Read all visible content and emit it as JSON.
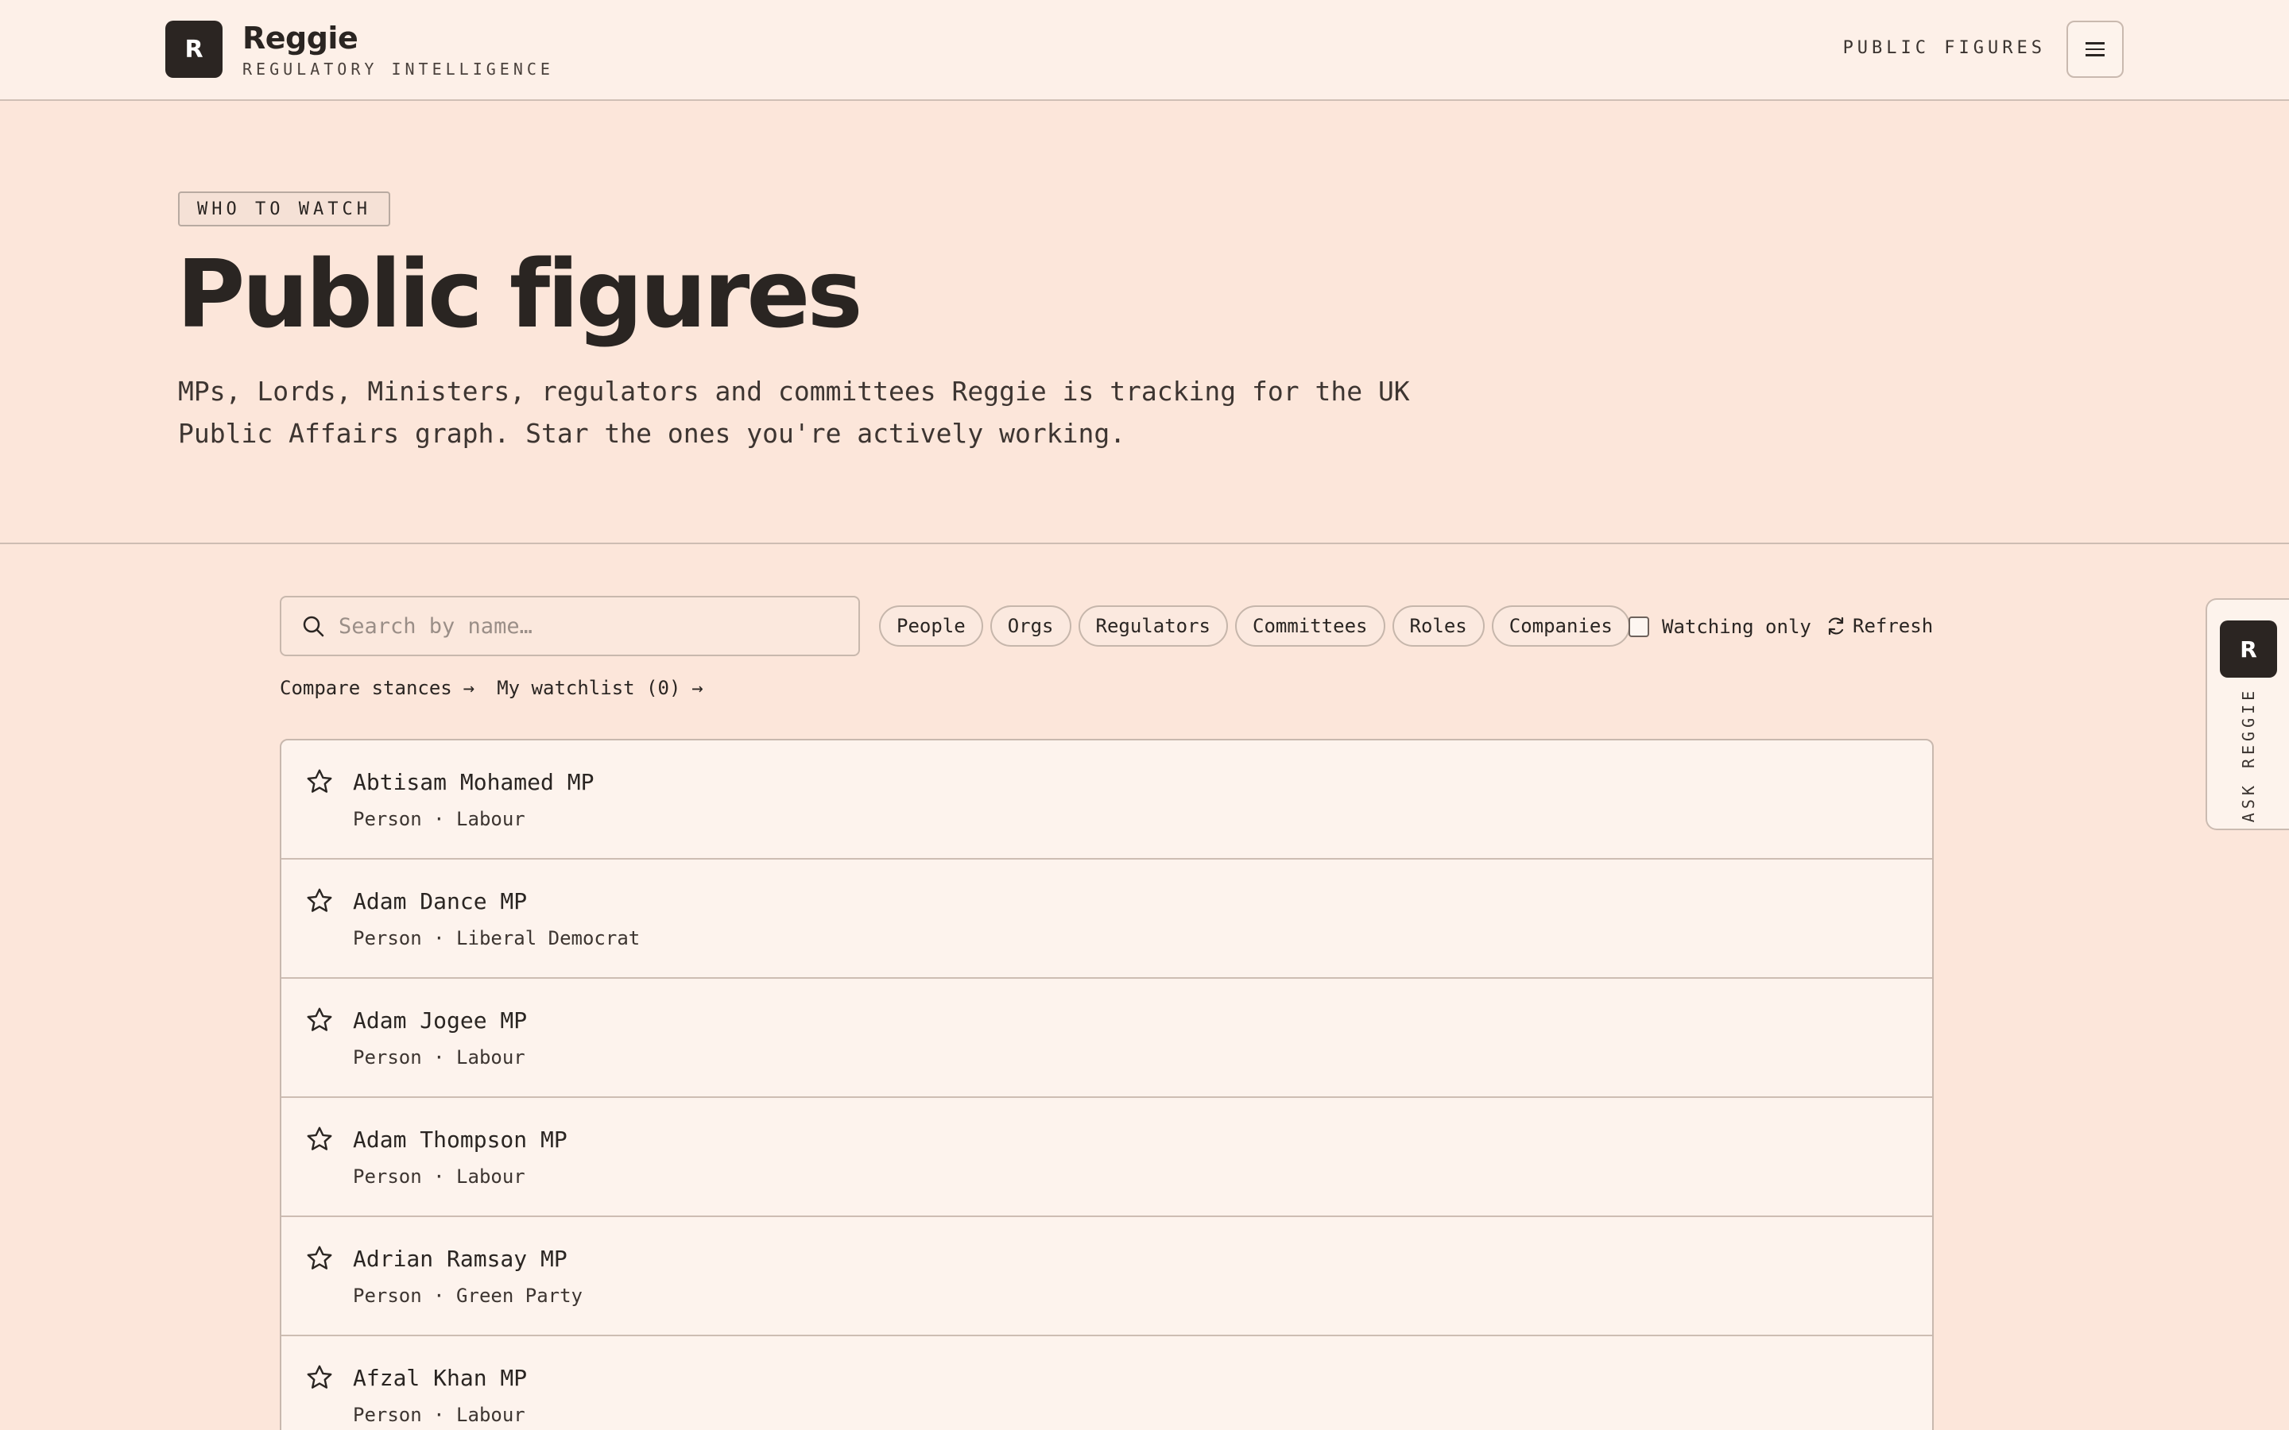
{
  "header": {
    "logo_letter": "R",
    "brand_name": "Reggie",
    "brand_sub": "REGULATORY INTELLIGENCE",
    "nav_link": "PUBLIC FIGURES"
  },
  "hero": {
    "tag": "WHO TO WATCH",
    "title": "Public figures",
    "description": "MPs, Lords, Ministers, regulators and committees Reggie is tracking for the UK Public Affairs graph. Star the ones you're actively working."
  },
  "search": {
    "placeholder": "Search by name…"
  },
  "filters": [
    "People",
    "Orgs",
    "Regulators",
    "Committees",
    "Roles",
    "Companies"
  ],
  "watching_only_label": "Watching only",
  "refresh_label": "Refresh",
  "links": {
    "compare": "Compare stances",
    "watchlist": "My watchlist (0)",
    "arrow": "→"
  },
  "rows": [
    {
      "name": "Abtisam Mohamed MP",
      "meta": "Person · Labour"
    },
    {
      "name": "Adam Dance MP",
      "meta": "Person · Liberal Democrat"
    },
    {
      "name": "Adam Jogee MP",
      "meta": "Person · Labour"
    },
    {
      "name": "Adam Thompson MP",
      "meta": "Person · Labour"
    },
    {
      "name": "Adrian Ramsay MP",
      "meta": "Person · Green Party"
    },
    {
      "name": "Afzal Khan MP",
      "meta": "Person · Labour"
    }
  ],
  "ask": {
    "logo_letter": "R",
    "label": "ASK REGGIE"
  },
  "icons": {
    "search": "search-icon",
    "star": "star-outline-icon",
    "refresh": "refresh-icon",
    "menu": "hamburger-menu-icon"
  },
  "colors": {
    "background": "#fce6da",
    "header_bg": "#fdf0e8",
    "dark": "#2b2522",
    "border": "#c8b8ae"
  }
}
